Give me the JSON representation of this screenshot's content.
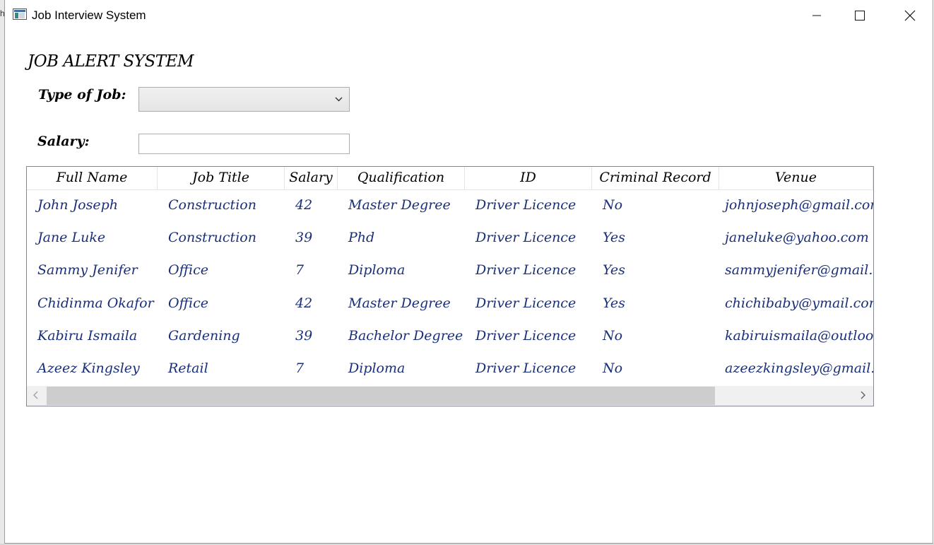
{
  "window": {
    "title": "Job Interview System",
    "partial_left_char": "h"
  },
  "heading": "JOB ALERT SYSTEM",
  "form": {
    "type_label": "Type of Job:",
    "type_value": "",
    "salary_label": "Salary:",
    "salary_value": ""
  },
  "grid": {
    "columns": [
      "Full Name",
      "Job Title",
      "Salary",
      "Qualification",
      "ID",
      "Criminal Record",
      "Venue"
    ],
    "rows": [
      [
        "John Joseph",
        "Construction",
        "42",
        "Master Degree",
        "Driver Licence",
        "No",
        "johnjoseph@gmail.com"
      ],
      [
        "Jane Luke",
        "Construction",
        "39",
        "Phd",
        "Driver Licence",
        "Yes",
        "janeluke@yahoo.com"
      ],
      [
        "Sammy Jenifer",
        "Office",
        "7",
        "Diploma",
        "Driver Licence",
        "Yes",
        "sammyjenifer@gmail.com"
      ],
      [
        "Chidinma Okafor",
        "Office",
        "42",
        "Master Degree",
        "Driver Licence",
        "Yes",
        "chichibaby@ymail.com"
      ],
      [
        "Kabiru Ismaila",
        " Gardening",
        "39",
        "Bachelor Degree",
        "Driver Licence",
        "No",
        "kabiruismaila@outlook.com"
      ],
      [
        "Azeez Kingsley",
        "Retail",
        "7",
        "Diploma",
        "Driver Licence",
        "No",
        "azeezkingsley@gmail.com"
      ]
    ]
  },
  "colors": {
    "cell_text": "#1a2f7a",
    "scroll_thumb": "#cdcdcd",
    "scroll_track": "#f0f0f0"
  }
}
